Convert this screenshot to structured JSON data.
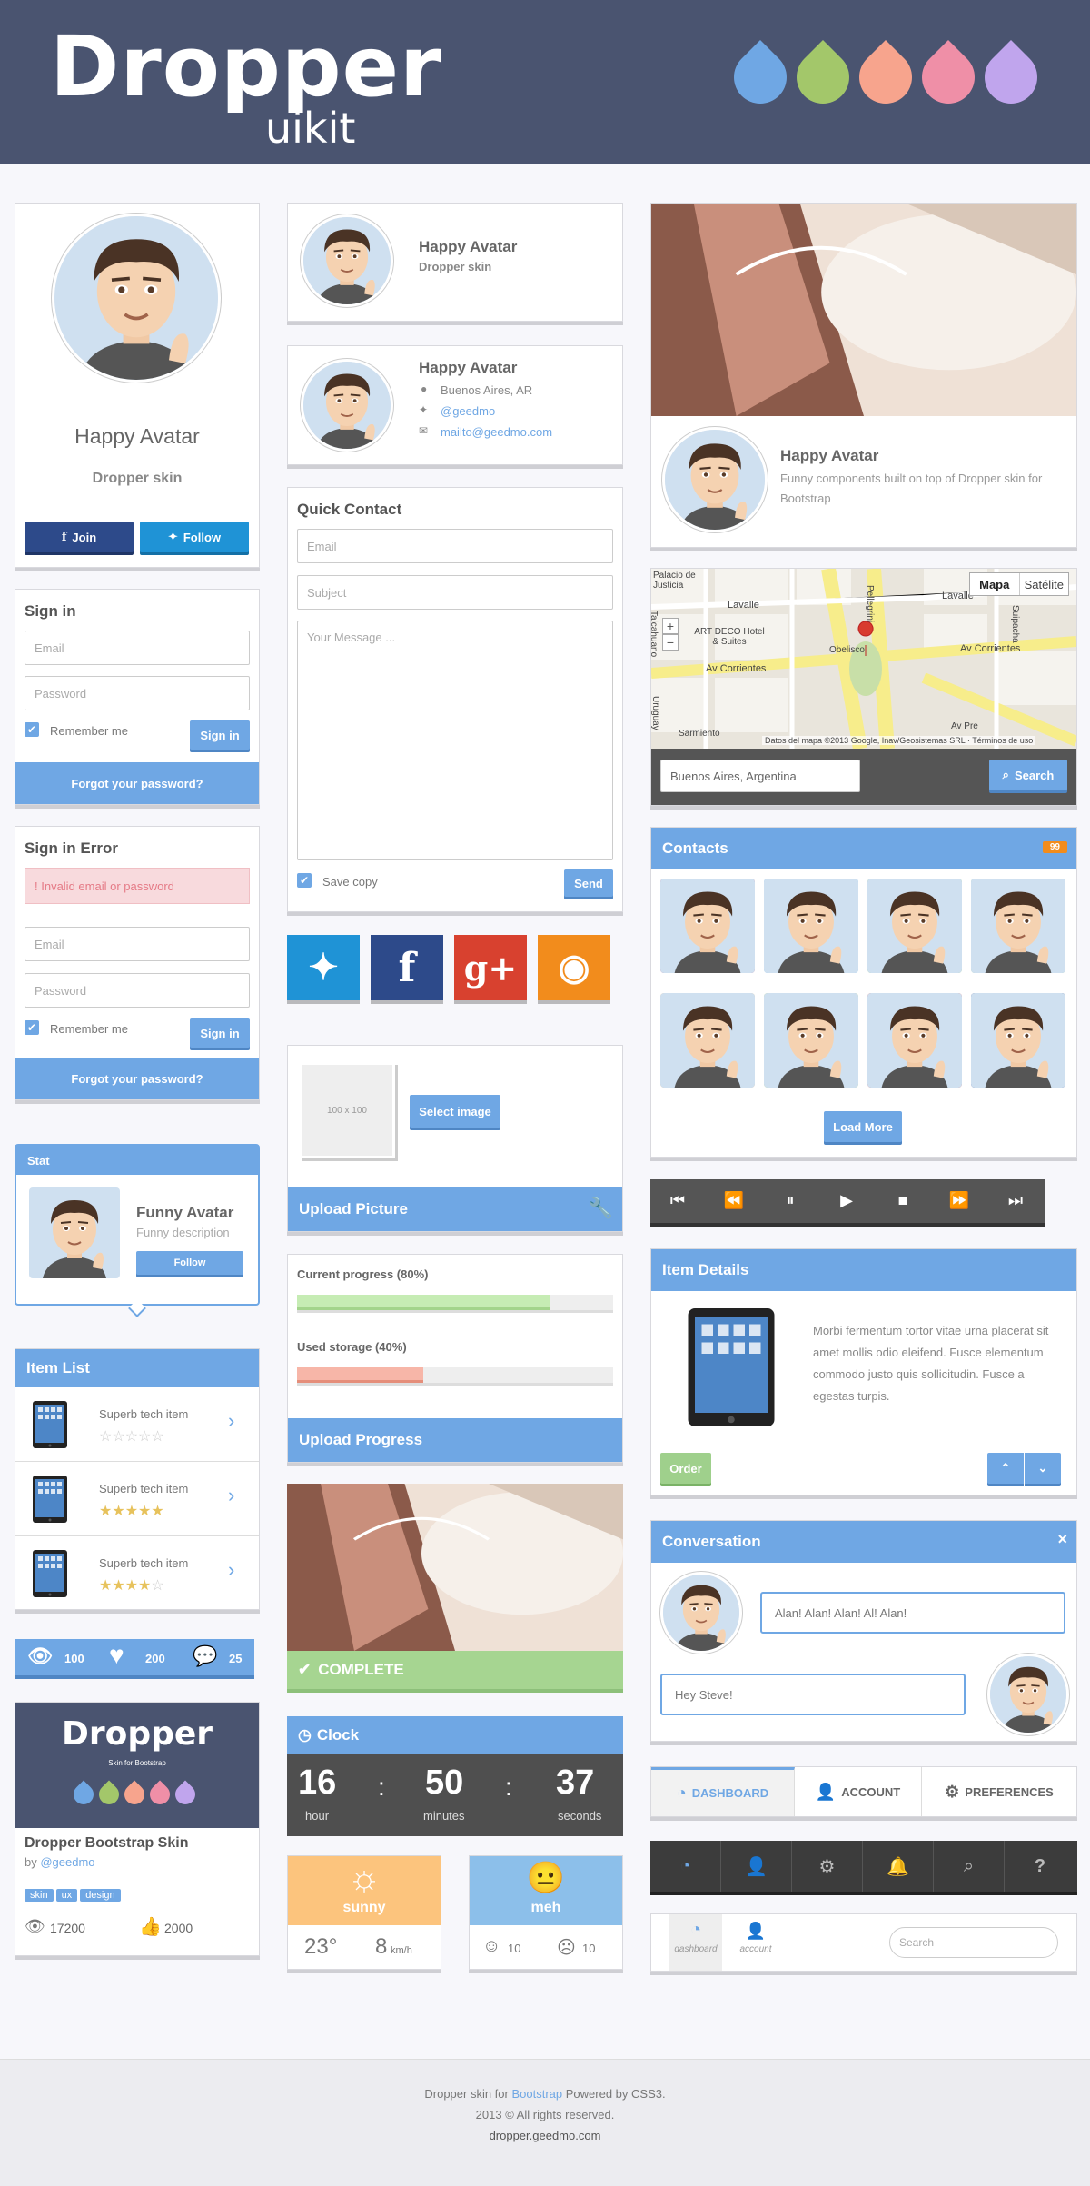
{
  "brand": {
    "title": "Dropper",
    "subtitle": "uikit",
    "drop_colors": [
      "#6fa7e4",
      "#a3c76a",
      "#f7a48d",
      "#ef8fa7",
      "#c0a5ed"
    ]
  },
  "profile": {
    "name": "Happy Avatar",
    "skin": "Dropper skin",
    "join": "Join",
    "follow": "Follow"
  },
  "signin": {
    "title": "Sign in",
    "email_ph": "Email",
    "password_ph": "Password",
    "remember": "Remember me",
    "button": "Sign in",
    "forgot": "Forgot your password?"
  },
  "signin_error": {
    "title": "Sign in Error",
    "error": "! Invalid email or password",
    "email_ph": "Email",
    "password_ph": "Password",
    "remember": "Remember me",
    "button": "Sign in",
    "forgot": "Forgot your password?"
  },
  "stat": {
    "header": "Stat",
    "name": "Funny Avatar",
    "desc": "Funny description",
    "follow": "Follow"
  },
  "item_list": {
    "title": "Item List",
    "items": [
      {
        "label": "Superb tech item",
        "stars": 0
      },
      {
        "label": "Superb tech item",
        "stars": 5
      },
      {
        "label": "Superb tech item",
        "stars": 4
      }
    ]
  },
  "counters": {
    "views": "100",
    "likes": "200",
    "comments": "25"
  },
  "skin_card": {
    "banner_title": "Dropper",
    "banner_sub": "Skin for Bootstrap",
    "title": "Dropper Bootstrap Skin",
    "by": "by",
    "author": "@geedmo",
    "tags": [
      "skin",
      "ux",
      "design"
    ],
    "views": "17200",
    "likes": "2000"
  },
  "mini_profile": {
    "name": "Happy Avatar",
    "skin": "Dropper skin"
  },
  "contact_card": {
    "name": "Happy Avatar",
    "location": "Buenos Aires, AR",
    "twitter": "@geedmo",
    "email": "mailto@geedmo.com"
  },
  "quick_contact": {
    "title": "Quick Contact",
    "email_ph": "Email",
    "subject_ph": "Subject",
    "message_ph": "Your Message ...",
    "save": "Save copy",
    "send": "Send"
  },
  "upload": {
    "placeholder": "100 x 100",
    "select": "Select image",
    "title": "Upload Picture"
  },
  "progress": {
    "current_label": "Current progress (80%)",
    "current": 0.8,
    "storage_label": "Used storage (40%)",
    "storage": 0.4,
    "title": "Upload Progress"
  },
  "complete": {
    "label": "COMPLETE"
  },
  "clock": {
    "title": "Clock",
    "hour": "16",
    "hour_label": "hour",
    "minutes": "50",
    "minutes_label": "minutes",
    "seconds": "37",
    "seconds_label": "seconds"
  },
  "weather": {
    "cond": "sunny",
    "temp": "23°",
    "wind": "8",
    "wind_unit": "km/h"
  },
  "mood": {
    "cond": "meh",
    "happy": "10",
    "sad": "10"
  },
  "hero": {
    "name": "Happy Avatar",
    "desc": "Funny components built on top of Dropper skin for Bootstrap"
  },
  "map": {
    "mapa": "Mapa",
    "satelite": "Satélite",
    "search_value": "Buenos Aires, Argentina",
    "search_btn": "Search",
    "streets": [
      "Lavalle",
      "Lavalle",
      "Av Corrientes",
      "Av Corrientes",
      "Obelisco",
      "ART DECO Hotel & Suites",
      "Pellegrini",
      "Suipacha",
      "Uruguay",
      "Talcahuano",
      "Palacio de Justicia",
      "Sarmiento",
      "Av Pre"
    ],
    "attribution": "Datos del mapa ©2013 Google, Inav/Geosistemas SRL · Términos de uso"
  },
  "contacts": {
    "title": "Contacts",
    "count": "99",
    "load": "Load More"
  },
  "item_details": {
    "title": "Item Details",
    "text": "Morbi fermentum tortor vitae urna placerat sit amet mollis odio eleifend. Fusce elementum commodo justo quis sollicitudin. Fusce a egestas turpis.",
    "order": "Order"
  },
  "conversation": {
    "title": "Conversation",
    "close": "×",
    "msg1": "Alan! Alan! Alan! Al! Alan!",
    "msg2": "Hey Steve!"
  },
  "tabs": {
    "dashboard": "DASHBOARD",
    "account": "ACCOUNT",
    "preferences": "PREFERENCES"
  },
  "bottom_nav": {
    "dashboard": "dashboard",
    "account": "account",
    "search_ph": "Search"
  },
  "footer": {
    "line1a": "Dropper skin for",
    "line1b": "Bootstrap",
    "line1c": "Powered by CSS3.",
    "line2": "2013 © All rights reserved.",
    "line3": "dropper.geedmo.com"
  }
}
